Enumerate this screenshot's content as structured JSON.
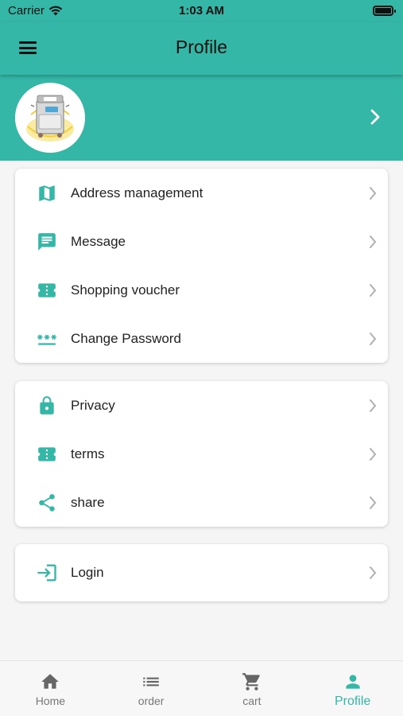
{
  "status_bar": {
    "carrier": "Carrier",
    "time": "1:03 AM"
  },
  "app_bar": {
    "title": "Profile",
    "menu_icon": "hamburger-icon"
  },
  "header": {
    "avatar": "washing-machine-image",
    "chevron_icon": "chevron-right-icon"
  },
  "menu_groups": [
    [
      {
        "label": "Address management",
        "icon": "map-icon"
      },
      {
        "label": "Message",
        "icon": "message-icon"
      },
      {
        "label": "Shopping voucher",
        "icon": "ticket-icon"
      },
      {
        "label": "Change Password",
        "icon": "password-icon"
      }
    ],
    [
      {
        "label": "Privacy",
        "icon": "lock-icon"
      },
      {
        "label": "terms",
        "icon": "ticket-icon"
      },
      {
        "label": "share",
        "icon": "share-icon"
      }
    ],
    [
      {
        "label": "Login",
        "icon": "login-icon"
      }
    ]
  ],
  "tab_bar": {
    "tabs": [
      {
        "label": "Home",
        "icon": "home-icon"
      },
      {
        "label": "order",
        "icon": "list-icon"
      },
      {
        "label": "cart",
        "icon": "cart-icon"
      },
      {
        "label": "Profile",
        "icon": "person-icon"
      }
    ],
    "active_index": 3
  },
  "colors": {
    "primary": "#34b7a7",
    "background": "#f5f5f5",
    "inactive": "#777777"
  }
}
